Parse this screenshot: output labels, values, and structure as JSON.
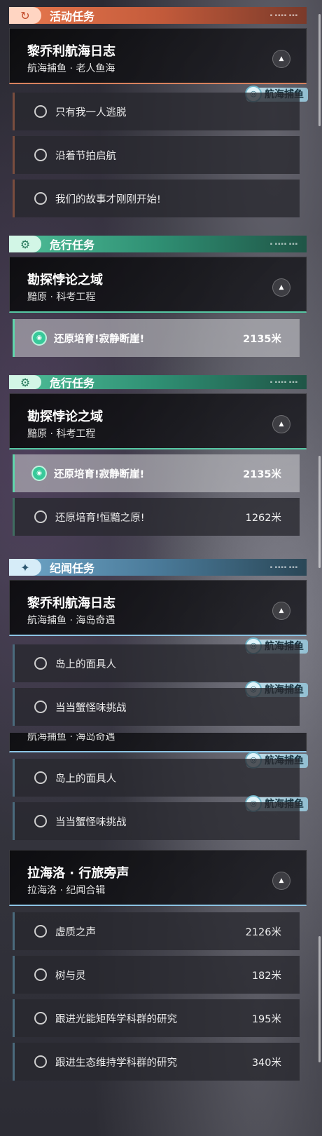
{
  "colors": {
    "activity": "#e8794f",
    "danger": "#4fbf99",
    "story": "#6fa6c8",
    "active_marker": "#38c99a"
  },
  "panel1": {
    "activity_header": {
      "title": "活动任务",
      "icon": "activity-quest-icon"
    },
    "activity_quest": {
      "title": "黎乔利航海日志",
      "subtitle": "航海捕鱼 · 老人鱼海"
    },
    "tag": "航海捕鱼",
    "tasks": [
      "只有我一人逃脱",
      "沿着节拍启航",
      "我们的故事才刚刚开始!"
    ],
    "danger_header": {
      "title": "危行任务",
      "icon": "danger-quest-icon"
    },
    "danger_quest": {
      "title": "勘探悖论之域",
      "subtitle": "黯原 · 科考工程"
    },
    "danger_tasks": [
      {
        "label": "还原培育!寂静断崖!",
        "distance": "2135米"
      }
    ]
  },
  "panel2": {
    "danger_header": {
      "title": "危行任务"
    },
    "danger_quest": {
      "title": "勘探悖论之域",
      "subtitle": "黯原 · 科考工程"
    },
    "danger_tasks": [
      {
        "label": "还原培育!寂静断崖!",
        "distance": "2135米"
      },
      {
        "label": "还原培育!恒黯之原!",
        "distance": "1262米"
      }
    ],
    "story_header": {
      "title": "纪闻任务",
      "icon": "story-quest-icon"
    },
    "story_quest": {
      "title": "黎乔利航海日志",
      "subtitle": "航海捕鱼 · 海岛奇遇"
    },
    "tag": "航海捕鱼",
    "story_tasks": [
      "岛上的面具人",
      "当当蟹怪味挑战"
    ]
  },
  "panel3": {
    "story_quest_subtitle": "航海捕鱼 · 海岛奇遇",
    "tag": "航海捕鱼",
    "story_tasks": [
      "岛上的面具人",
      "当当蟹怪味挑战"
    ],
    "quest2": {
      "title": "拉海洛 · 行旅旁声",
      "subtitle": "拉海洛 · 纪闻合辑"
    },
    "quest2_tasks": [
      {
        "label": "虚质之声",
        "distance": "2126米"
      },
      {
        "label": "树与灵",
        "distance": "182米"
      },
      {
        "label": "跟进光能矩阵学科群的研究",
        "distance": "195米"
      },
      {
        "label": "跟进生态维持学科群的研究",
        "distance": "340米"
      }
    ]
  }
}
